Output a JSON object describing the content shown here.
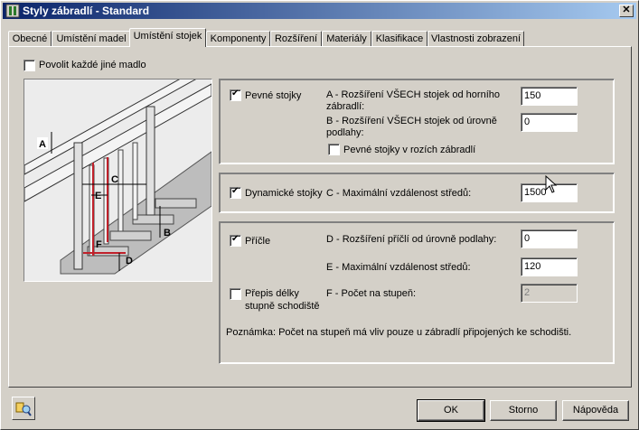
{
  "window": {
    "title": "Styly zábradlí - Standard",
    "close_label": "✕"
  },
  "tabs": [
    {
      "label": "Obecné"
    },
    {
      "label": "Umístění madel"
    },
    {
      "label": "Umístění stojek"
    },
    {
      "label": "Komponenty"
    },
    {
      "label": "Rozšíření"
    },
    {
      "label": "Materiály"
    },
    {
      "label": "Klasifikace"
    },
    {
      "label": "Vlastnosti zobrazení"
    }
  ],
  "active_tab": "Umístění stojek",
  "allow_every_other": {
    "label": "Povolit každé jiné madlo",
    "checked": false
  },
  "diagram": {
    "labels": [
      "A",
      "B",
      "C",
      "D",
      "E",
      "F"
    ]
  },
  "fixed_posts": {
    "label": "Pevné stojky",
    "checked": true,
    "a_label": "A - Rozšíření VŠECH stojek od horního zábradlí:",
    "a_value": "150",
    "b_label": "B - Rozšíření VŠECH stojek od úrovně podlahy:",
    "b_value": "0",
    "corner_label": "Pevné stojky v rozích zábradlí",
    "corner_checked": false
  },
  "dynamic_posts": {
    "label": "Dynamické stojky",
    "checked": true,
    "c_label": "C - Maximální vzdálenost středů:",
    "c_value": "1500"
  },
  "balusters": {
    "label": "Příčle",
    "checked": true,
    "d_label": "D - Rozšíření příčlí od úrovně podlahy:",
    "d_value": "0",
    "e_label": "E - Maximální vzdálenost středů:",
    "e_value": "120",
    "override_label_1": "Přepis délky",
    "override_label_2": "stupně schodiště",
    "override_checked": false,
    "f_label": "F - Počet na stupeň:",
    "f_value": "2"
  },
  "note": "Poznámka: Počet na stupeň má vliv pouze u zábradlí připojených ke schodišti.",
  "buttons": {
    "ok": "OK",
    "cancel": "Storno",
    "help": "Nápověda"
  }
}
